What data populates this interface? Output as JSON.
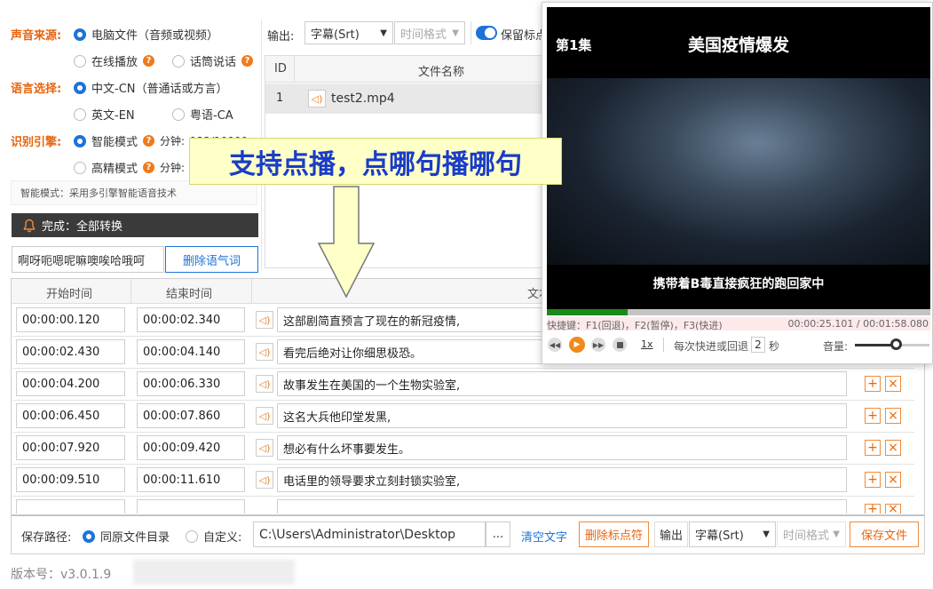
{
  "source": {
    "label": "声音来源:",
    "options": [
      "电脑文件（音频或视频）",
      "在线播放",
      "话筒说话"
    ]
  },
  "language": {
    "label": "语言选择:",
    "options": [
      "中文-CN（普通话或方言）",
      "英文-EN",
      "粤语-CA"
    ]
  },
  "engine": {
    "label": "识别引擎:",
    "options": [
      "智能模式",
      "高精模式"
    ],
    "minutes_label": "分钟:",
    "minutes_value": "122/10000",
    "note": "智能模式：采用多引擎智能语音技术"
  },
  "status": {
    "text": "完成：全部转换"
  },
  "filler": {
    "words": "啊呀呃嗯呢嘛噢唉哈哦呵",
    "button": "删除语气词"
  },
  "output": {
    "label": "输出:",
    "format": "字幕(Srt)",
    "time_format": "时间格式",
    "keep_label": "保留标点"
  },
  "files": {
    "headers": [
      "ID",
      "文件名称"
    ],
    "rows": [
      {
        "id": "1",
        "name": "test2.mp4"
      }
    ]
  },
  "callout": {
    "text": "支持点播，点哪句播哪句"
  },
  "player": {
    "episode": "第1集",
    "title": "美国疫情爆发",
    "subtitle": "携带着B毒直接疯狂的跑回家中",
    "progress": 0.21,
    "shortcuts": "快捷键：F1(回退)，F2(暂停)，F3(快进)",
    "time": "00:00:25.101 / 00:01:58.080",
    "speed": "1x",
    "skip_label": "每次快进或回退",
    "skip_value": "2",
    "skip_unit": "秒",
    "volume_label": "音量:",
    "volume": 0.55
  },
  "subtitles": {
    "headers": [
      "开始时间",
      "结束时间",
      "文本"
    ],
    "rows": [
      {
        "start": "00:00:00.120",
        "end": "00:00:02.340",
        "text": "这部剧简直预言了现在的新冠疫情,"
      },
      {
        "start": "00:00:02.430",
        "end": "00:00:04.140",
        "text": "看完后绝对让你细思极恐。"
      },
      {
        "start": "00:00:04.200",
        "end": "00:00:06.330",
        "text": "故事发生在美国的一个生物实验室,"
      },
      {
        "start": "00:00:06.450",
        "end": "00:00:07.860",
        "text": "这名大兵他印堂发黑,"
      },
      {
        "start": "00:00:07.920",
        "end": "00:00:09.420",
        "text": "想必有什么坏事要发生。"
      },
      {
        "start": "00:00:09.510",
        "end": "00:00:11.610",
        "text": "电话里的领导要求立刻封锁实验室,"
      }
    ]
  },
  "bottom": {
    "path_label": "保存路径:",
    "same_dir": "同原文件目录",
    "custom": "自定义:",
    "path": "C:\\Users\\Administrator\\Desktop",
    "dots": "...",
    "clear": "清空文字",
    "delete_marks": "删除标点符",
    "output_label": "输出",
    "format": "字幕(Srt)",
    "time_format": "时间格式",
    "save": "保存文件"
  },
  "version": "版本号：v3.0.1.9"
}
